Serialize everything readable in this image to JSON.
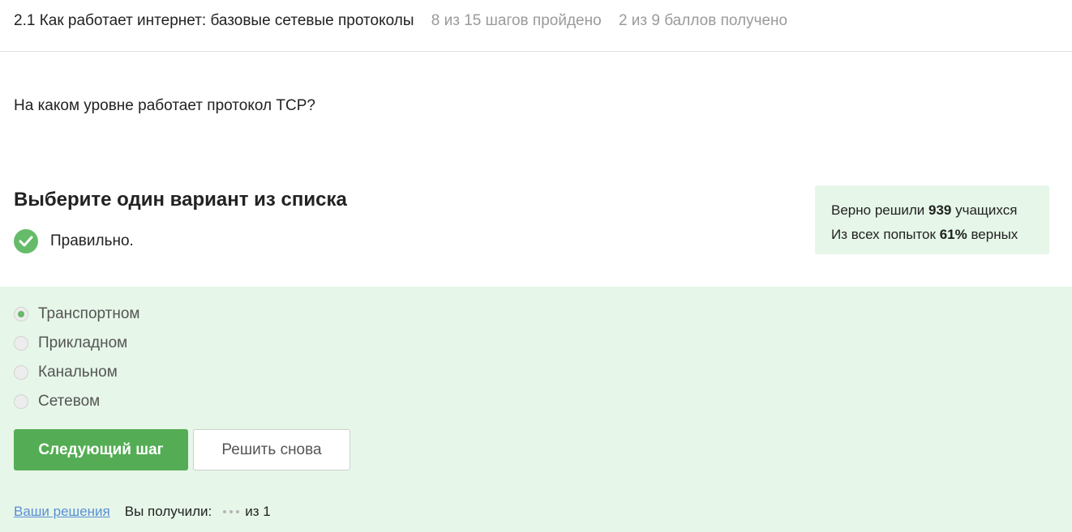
{
  "header": {
    "title": "2.1 Как работает интернет: базовые сетевые протоколы",
    "steps_progress": "8 из 15 шагов пройдено",
    "score_progress": "2 из 9 баллов  получено"
  },
  "question": "На каком уровне работает протокол TCP?",
  "prompt": "Выберите один вариант из списка",
  "result": {
    "text": "Правильно.",
    "icon": "check-circle-icon"
  },
  "stats": {
    "line1_prefix": "Верно решили ",
    "line1_value": "939",
    "line1_suffix": " учащихся",
    "line2_prefix": "Из всех попыток ",
    "line2_value": "61%",
    "line2_suffix": " верных"
  },
  "options": [
    {
      "label": "Транспортном",
      "selected": true
    },
    {
      "label": "Прикладном",
      "selected": false
    },
    {
      "label": "Канальном",
      "selected": false
    },
    {
      "label": "Сетевом",
      "selected": false
    }
  ],
  "buttons": {
    "next": "Следующий шаг",
    "retry": "Решить снова"
  },
  "footer": {
    "solutions_link": "Ваши решения",
    "received_label": "Вы получили:",
    "of_total": "из 1"
  },
  "colors": {
    "accent_green": "#54ad54",
    "success_green": "#66bb6a",
    "panel_bg": "#e6f6e8",
    "link_blue": "#5a8fd6"
  }
}
